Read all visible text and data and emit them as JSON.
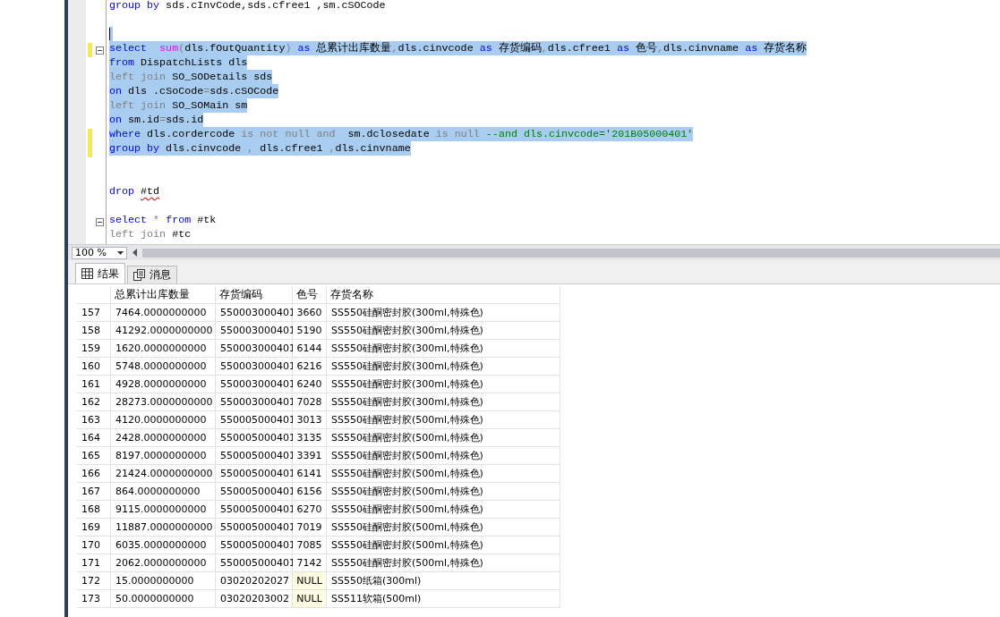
{
  "editor": {
    "lines": [
      {
        "tokens": [
          {
            "text": "group by",
            "kind": "keyword"
          },
          {
            "text": " sds.cInvCode,sds.cfree1 ,sm.cSOCode",
            "kind": "plain"
          }
        ],
        "selected": false,
        "changed": false,
        "fold": false,
        "caret": false
      },
      {
        "selected": false,
        "changed": false,
        "fold": false,
        "caret": false
      },
      {
        "selected": true,
        "changed": false,
        "fold": false,
        "caret": true
      },
      {
        "tokens": [
          {
            "text": "select  ",
            "kind": "keyword"
          },
          {
            "text": "sum",
            "kind": "function"
          },
          {
            "text": "(",
            "kind": "operator"
          },
          {
            "text": "dls.fOutQuantity",
            "kind": "plain"
          },
          {
            "text": ")",
            "kind": "operator"
          },
          {
            "text": " as",
            "kind": "keyword"
          },
          {
            "text": " 总累计出库数量",
            "kind": "plain"
          },
          {
            "text": ",",
            "kind": "operator"
          },
          {
            "text": "dls.cinvcode ",
            "kind": "plain"
          },
          {
            "text": "as",
            "kind": "keyword"
          },
          {
            "text": " 存货编码",
            "kind": "plain"
          },
          {
            "text": ",",
            "kind": "operator"
          },
          {
            "text": "dls.cfree1 ",
            "kind": "plain"
          },
          {
            "text": "as",
            "kind": "keyword"
          },
          {
            "text": " 色号",
            "kind": "plain"
          },
          {
            "text": ",",
            "kind": "operator"
          },
          {
            "text": "dls.cinvname ",
            "kind": "plain"
          },
          {
            "text": "as",
            "kind": "keyword"
          },
          {
            "text": " 存货名称",
            "kind": "plain"
          }
        ],
        "selected": true,
        "changed": true,
        "fold": true,
        "caret": false
      },
      {
        "tokens": [
          {
            "text": "from",
            "kind": "keyword"
          },
          {
            "text": " DispatchLists dls",
            "kind": "plain"
          }
        ],
        "selected": true,
        "changed": false,
        "fold": false,
        "caret": false
      },
      {
        "tokens": [
          {
            "text": "left join",
            "kind": "operator"
          },
          {
            "text": " SO_SODetails sds",
            "kind": "plain"
          }
        ],
        "selected": true,
        "changed": false,
        "fold": false,
        "caret": false
      },
      {
        "tokens": [
          {
            "text": "on",
            "kind": "keyword"
          },
          {
            "text": " dls .cSoCode",
            "kind": "plain"
          },
          {
            "text": "=",
            "kind": "operator"
          },
          {
            "text": "sds.cSOCode",
            "kind": "plain"
          }
        ],
        "selected": true,
        "changed": false,
        "fold": false,
        "caret": false
      },
      {
        "tokens": [
          {
            "text": "left join",
            "kind": "operator"
          },
          {
            "text": " SO_SOMain sm",
            "kind": "plain"
          }
        ],
        "selected": true,
        "changed": false,
        "fold": false,
        "caret": false
      },
      {
        "tokens": [
          {
            "text": "on",
            "kind": "keyword"
          },
          {
            "text": " sm.id",
            "kind": "plain"
          },
          {
            "text": "=",
            "kind": "operator"
          },
          {
            "text": "sds.id",
            "kind": "plain"
          }
        ],
        "selected": true,
        "changed": false,
        "fold": false,
        "caret": false
      },
      {
        "tokens": [
          {
            "text": "where",
            "kind": "keyword"
          },
          {
            "text": " dls.cordercode ",
            "kind": "plain"
          },
          {
            "text": "is not null and",
            "kind": "operator"
          },
          {
            "text": "  sm.dclosedate ",
            "kind": "plain"
          },
          {
            "text": "is null",
            "kind": "operator"
          },
          {
            "text": " --and dls.cinvcode='201B05000401'",
            "kind": "comment"
          }
        ],
        "selected": true,
        "changed": true,
        "fold": false,
        "caret": false
      },
      {
        "tokens": [
          {
            "text": "group by",
            "kind": "keyword"
          },
          {
            "text": " dls.cinvcode ",
            "kind": "plain"
          },
          {
            "text": ",",
            "kind": "operator"
          },
          {
            "text": " dls.cfree1 ",
            "kind": "plain"
          },
          {
            "text": ",",
            "kind": "operator"
          },
          {
            "text": "dls.cinvname",
            "kind": "plain"
          }
        ],
        "selected": true,
        "changed": true,
        "fold": false,
        "caret": false
      },
      {
        "selected": false,
        "changed": false,
        "fold": false,
        "caret": false
      },
      {
        "selected": false,
        "changed": false,
        "fold": false,
        "caret": false
      },
      {
        "tokens": [
          {
            "text": "drop ",
            "kind": "keyword"
          },
          {
            "text": "#td",
            "kind": "error"
          }
        ],
        "selected": false,
        "changed": false,
        "fold": false,
        "caret": false
      },
      {
        "selected": false,
        "changed": false,
        "fold": false,
        "caret": false
      },
      {
        "tokens": [
          {
            "text": "select ",
            "kind": "keyword"
          },
          {
            "text": "* ",
            "kind": "operator"
          },
          {
            "text": "from",
            "kind": "keyword"
          },
          {
            "text": " #tk",
            "kind": "plain"
          }
        ],
        "selected": false,
        "changed": false,
        "fold": true,
        "caret": false
      },
      {
        "tokens": [
          {
            "text": "left join",
            "kind": "operator"
          },
          {
            "text": " #tc",
            "kind": "plain"
          }
        ],
        "selected": false,
        "changed": false,
        "fold": false,
        "caret": false
      }
    ]
  },
  "zoom": {
    "value": "100 %"
  },
  "tabs": [
    {
      "label": "结果",
      "kind": "grid",
      "selected": true
    },
    {
      "label": "消息",
      "kind": "messages",
      "selected": false
    }
  ],
  "results": {
    "columns": [
      "总累计出库数量",
      "存货编码",
      "色号",
      "存货名称"
    ],
    "rows": [
      {
        "number": "157",
        "cells": [
          "7464.0000000000",
          "550003000401",
          "3660",
          "SS550硅酮密封胶(300ml,特殊色)"
        ],
        "null_color": false
      },
      {
        "number": "158",
        "cells": [
          "41292.0000000000",
          "550003000401",
          "5190",
          "SS550硅酮密封胶(300ml,特殊色)"
        ],
        "null_color": false
      },
      {
        "number": "159",
        "cells": [
          "1620.0000000000",
          "550003000401",
          "6144",
          "SS550硅酮密封胶(300ml,特殊色)"
        ],
        "null_color": false
      },
      {
        "number": "160",
        "cells": [
          "5748.0000000000",
          "550003000401",
          "6216",
          "SS550硅酮密封胶(300ml,特殊色)"
        ],
        "null_color": false
      },
      {
        "number": "161",
        "cells": [
          "4928.0000000000",
          "550003000401",
          "6240",
          "SS550硅酮密封胶(300ml,特殊色)"
        ],
        "null_color": false
      },
      {
        "number": "162",
        "cells": [
          "28273.0000000000",
          "550003000401",
          "7028",
          "SS550硅酮密封胶(300ml,特殊色)"
        ],
        "null_color": false
      },
      {
        "number": "163",
        "cells": [
          "4120.0000000000",
          "550005000401",
          "3013",
          "SS550硅酮密封胶(500ml,特殊色)"
        ],
        "null_color": false
      },
      {
        "number": "164",
        "cells": [
          "2428.0000000000",
          "550005000401",
          "3135",
          "SS550硅酮密封胶(500ml,特殊色)"
        ],
        "null_color": false
      },
      {
        "number": "165",
        "cells": [
          "8197.0000000000",
          "550005000401",
          "3391",
          "SS550硅酮密封胶(500ml,特殊色)"
        ],
        "null_color": false
      },
      {
        "number": "166",
        "cells": [
          "21424.0000000000",
          "550005000401",
          "6141",
          "SS550硅酮密封胶(500ml,特殊色)"
        ],
        "null_color": false
      },
      {
        "number": "167",
        "cells": [
          "864.0000000000",
          "550005000401",
          "6156",
          "SS550硅酮密封胶(500ml,特殊色)"
        ],
        "null_color": false
      },
      {
        "number": "168",
        "cells": [
          "9115.0000000000",
          "550005000401",
          "6270",
          "SS550硅酮密封胶(500ml,特殊色)"
        ],
        "null_color": false
      },
      {
        "number": "169",
        "cells": [
          "11887.0000000000",
          "550005000401",
          "7019",
          "SS550硅酮密封胶(500ml,特殊色)"
        ],
        "null_color": false
      },
      {
        "number": "170",
        "cells": [
          "6035.0000000000",
          "550005000401",
          "7085",
          "SS550硅酮密封胶(500ml,特殊色)"
        ],
        "null_color": false
      },
      {
        "number": "171",
        "cells": [
          "2062.0000000000",
          "550005000401",
          "7142",
          "SS550硅酮密封胶(500ml,特殊色)"
        ],
        "null_color": false
      },
      {
        "number": "172",
        "cells": [
          "15.0000000000",
          "03020202027",
          "NULL",
          "SS550纸箱(300ml)"
        ],
        "null_color": true
      },
      {
        "number": "173",
        "cells": [
          "50.0000000000",
          "03020203002",
          "NULL",
          "SS511软箱(500ml)"
        ],
        "null_color": true
      }
    ]
  }
}
